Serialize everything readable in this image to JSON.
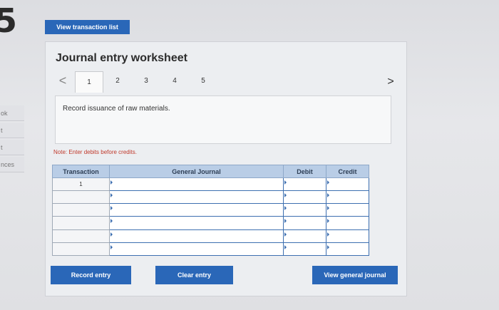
{
  "header": {
    "question_number": "5",
    "view_transaction_list_label": "View transaction list"
  },
  "side_stubs": [
    "ok",
    "t",
    "t",
    "nces"
  ],
  "worksheet": {
    "title": "Journal entry worksheet",
    "pager": {
      "prev_symbol": "<",
      "next_symbol": ">",
      "tabs": [
        "1",
        "2",
        "3",
        "4",
        "5"
      ],
      "active_tab": "1"
    },
    "description": "Record issuance of raw materials.",
    "note": "Note: Enter debits before credits."
  },
  "journal_table": {
    "columns": [
      "Transaction",
      "General Journal",
      "Debit",
      "Credit"
    ],
    "rows": [
      {
        "transaction": "1",
        "account": "",
        "debit": "",
        "credit": ""
      },
      {
        "transaction": "",
        "account": "",
        "debit": "",
        "credit": ""
      },
      {
        "transaction": "",
        "account": "",
        "debit": "",
        "credit": ""
      },
      {
        "transaction": "",
        "account": "",
        "debit": "",
        "credit": ""
      },
      {
        "transaction": "",
        "account": "",
        "debit": "",
        "credit": ""
      },
      {
        "transaction": "",
        "account": "",
        "debit": "",
        "credit": ""
      }
    ]
  },
  "buttons": {
    "record_entry": "Record entry",
    "clear_entry": "Clear entry",
    "view_general_journal": "View general journal"
  },
  "colors": {
    "button_blue": "#2a67b8",
    "table_header": "#b9cde6",
    "note_red": "#c0392b"
  }
}
